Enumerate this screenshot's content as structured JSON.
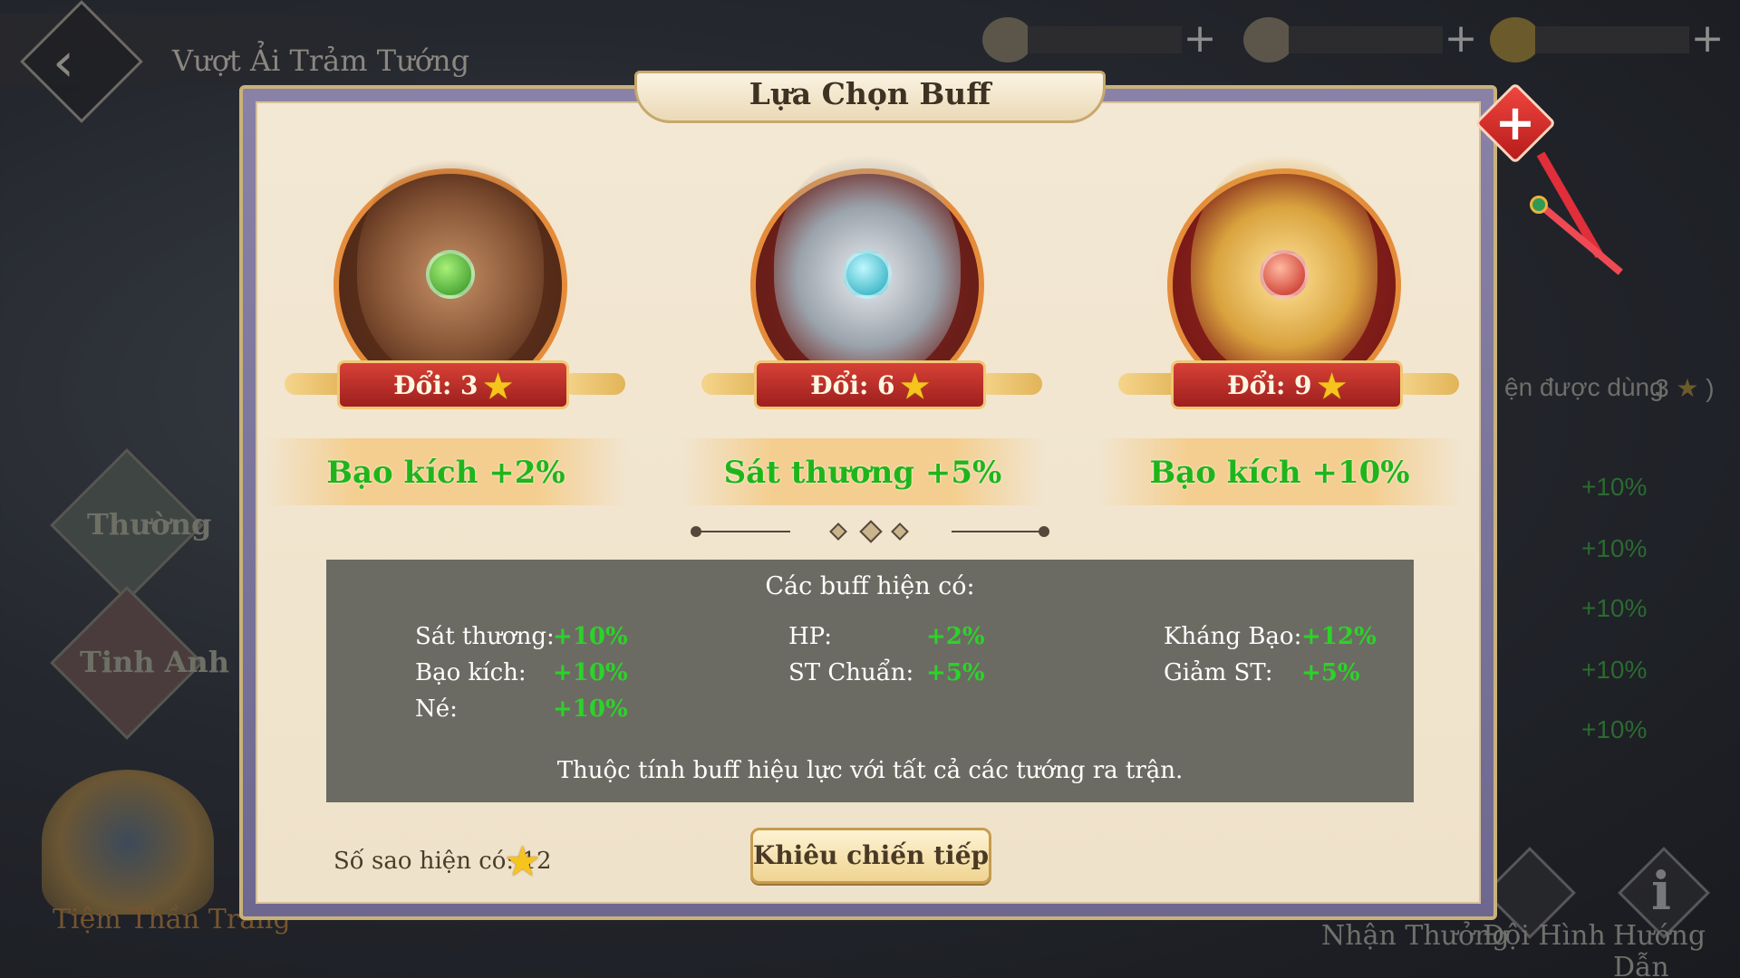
{
  "header": {
    "title": "Vượt Ải Trảm Tướng",
    "currencies": [
      {
        "icon": "silver-ingot-icon",
        "plus": "+"
      },
      {
        "icon": "coins-icon",
        "plus": "+"
      },
      {
        "icon": "gold-ingot-icon",
        "plus": "+"
      }
    ]
  },
  "sidebar": {
    "modes": [
      {
        "label": "Thường"
      },
      {
        "label": "Tinh Anh"
      }
    ],
    "shop_label": "Tiệm Thần Trang"
  },
  "right_panel": {
    "hint": "ện được dùng",
    "hint_count": "3",
    "hint_close": ")",
    "values": [
      "+10%",
      "+10%",
      "+10%",
      "+10%",
      "+10%"
    ]
  },
  "bottom_nav": {
    "claim_label": "Nhận Thưởng",
    "team_label": "Đội Hình",
    "guide_label": "Hướng Dẫn"
  },
  "modal": {
    "title": "Lựa Chọn Buff",
    "cards": [
      {
        "cost": "Đổi: 3",
        "effect": "Bạo kích +2%",
        "tier": "bronze"
      },
      {
        "cost": "Đổi: 6",
        "effect": "Sát thương +5%",
        "tier": "silver"
      },
      {
        "cost": "Đổi: 9",
        "effect": "Bạo kích +10%",
        "tier": "gold"
      }
    ],
    "panel_title": "Các buff hiện có:",
    "stats": [
      {
        "label": "Sát thương:",
        "value": "+10%"
      },
      {
        "label": "Bạo kích:",
        "value": "+10%"
      },
      {
        "label": "Né:",
        "value": "+10%"
      },
      {
        "label": "HP:",
        "value": "+2%"
      },
      {
        "label": "ST Chuẩn:",
        "value": "+5%"
      },
      {
        "label": "Kháng Bạo:",
        "value": "+12%"
      },
      {
        "label": "Giảm ST:",
        "value": "+5%"
      }
    ],
    "note": "Thuộc tính buff hiệu lực với tất cả các tướng ra trận.",
    "stars_owned": "Số sao hiện có: 12",
    "continue_label": "Khiêu chiến tiếp"
  },
  "colors": {
    "effect_green": "#1fb51a",
    "stat_green": "#2ad428",
    "ribbon_red": "#c83a30",
    "star_gold": "#f6c51d",
    "panel_gray": "#6c6b63"
  }
}
